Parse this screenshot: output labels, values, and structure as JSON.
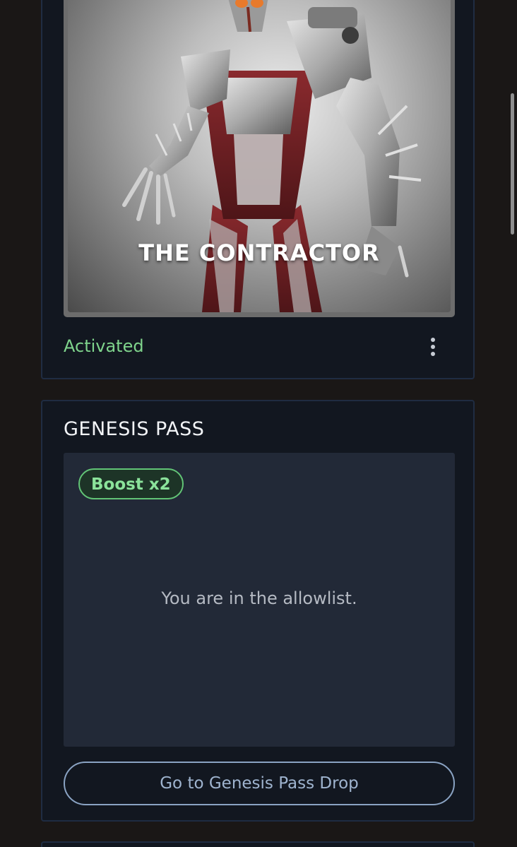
{
  "nft_card": {
    "title": "THE CONTRACTOR",
    "status": "Activated",
    "status_color": "#7fd48c",
    "more_icon": "vertical-ellipsis-icon"
  },
  "genesis_pass": {
    "heading": "GENESIS PASS",
    "badge": "Boost x2",
    "badge_color": "#62c476",
    "message": "You are in the allowlist.",
    "button_label": "Go to Genesis Pass Drop"
  }
}
